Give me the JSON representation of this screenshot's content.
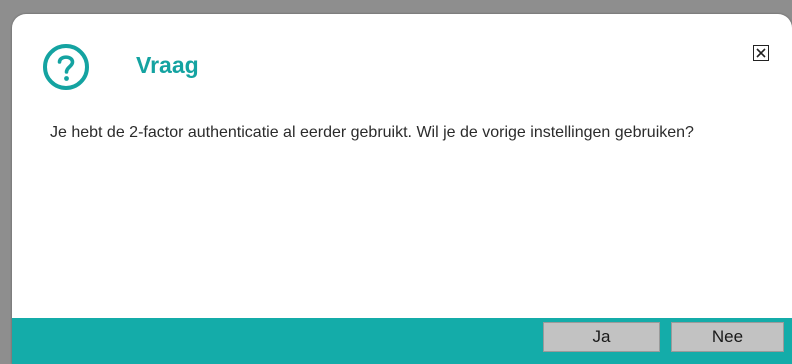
{
  "dialog": {
    "title": "Vraag",
    "message": "Je hebt de 2-factor authenticatie al eerder gebruikt. Wil je de vorige instellingen gebruiken?",
    "icon": "question-circle-icon",
    "close_icon": "close-icon",
    "accent_color": "#14a3a1",
    "footer_color": "#14aca9"
  },
  "buttons": {
    "yes_label": "Ja",
    "no_label": "Nee"
  }
}
